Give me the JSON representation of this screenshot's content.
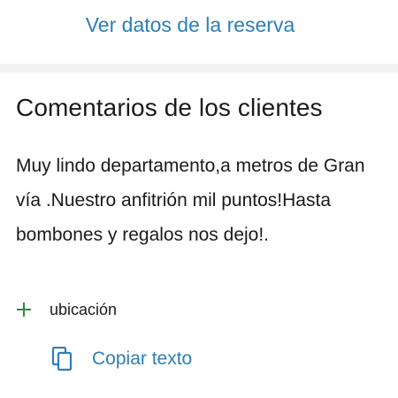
{
  "reservation": {
    "view_link_label": "Ver datos de la reserva"
  },
  "reviews": {
    "title": "Comentarios de los clientes",
    "comment": "Muy lindo departamento,a metros de Gran vía .Nuestro anfitrión mil puntos!Hasta bombones y regalos nos dejo!.",
    "positive_tag": {
      "icon": "plus-icon",
      "label": "ubicación"
    },
    "copy_action": {
      "icon": "copy-icon",
      "label": "Copiar texto"
    }
  },
  "colors": {
    "link": "#2c7fb8",
    "positive": "#2e8b3e",
    "text": "#1a1a1a",
    "divider": "#f1f1f1"
  }
}
